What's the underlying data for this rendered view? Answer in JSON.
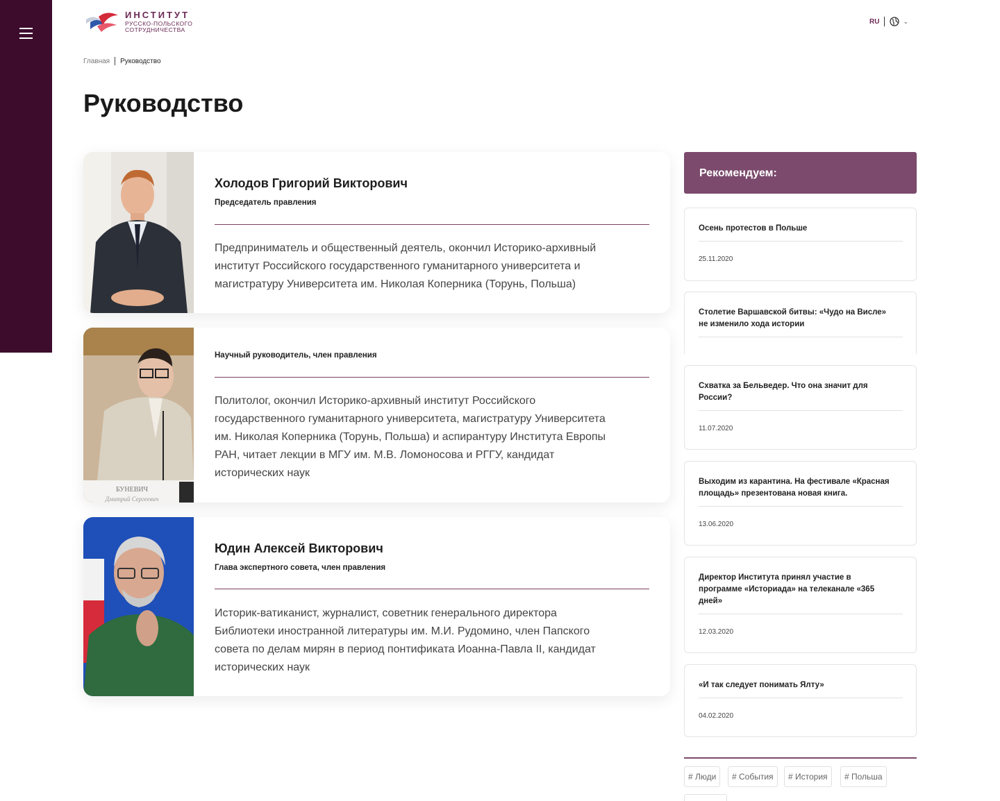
{
  "header": {
    "logo_title": "ИНСТИТУТ",
    "logo_line1": "РУССКО-ПОЛЬСКОГО",
    "logo_line2": "СОТРУДНИЧЕСТВА",
    "lang": "RU",
    "globe_icon": "globe-icon",
    "menu_icon": "hamburger-menu-icon"
  },
  "breadcrumb": {
    "home": "Главная",
    "current": "Руководство"
  },
  "page_title": "Руководство",
  "people": [
    {
      "name": "Холодов Григорий Викторович",
      "role": "Председатель правления",
      "desc_lines": [
        "Предприниматель и общественный деятель, окончил Историко-архивный",
        "институт Российского государственного гуманитарного университета и",
        "магистратуру Университета им. Николая Коперника (Торунь, Польша)"
      ]
    },
    {
      "name": "",
      "role": "Научный руководитель, член правления",
      "photo_caption_1": "БУНЕВИЧ",
      "photo_caption_2": "Дмитрий Сергеевич",
      "desc_lines": [
        "Политолог, окончил Историко-архивный институт Российского",
        "государственного гуманитарного университета, магистратуру Университета",
        "им. Николая Коперника (Торунь, Польша) и аспирантуру Института Европы",
        "РАН, читает лекции в МГУ им. М.В. Ломоносова и РГГУ, кандидат",
        "исторических наук"
      ]
    },
    {
      "name": "Юдин Алексей Викторович",
      "role": "Глава экспертного совета, член правления",
      "desc_lines": [
        "Историк-ватиканист, журналист, советник генерального директора",
        "Библиотеки иностранной литературы им. М.И. Рудомино, член Папского",
        "совета по делам мирян в период понтификата Иоанна-Павла II, кандидат",
        "исторических наук"
      ]
    }
  ],
  "recommend": {
    "heading": "Рекомендуем:",
    "items": [
      {
        "title_lines": [
          "Осень протестов в Польше"
        ],
        "date": "25.11.2020"
      },
      {
        "title_lines": [
          "Столетие Варшавской битвы: «Чудо на Висле»",
          "не изменило хода истории"
        ],
        "date": ""
      },
      {
        "title_lines": [
          "Схватка за Бельведер. Что она значит для",
          "России?"
        ],
        "date": "11.07.2020"
      },
      {
        "title_lines": [
          "Выходим из карантина. На фестивале «Красная",
          "площадь» презентована новая книга."
        ],
        "date": "13.06.2020"
      },
      {
        "title_lines": [
          "Директор Института принял участие в",
          "программе «Историада» на телеканале «365",
          "дней»"
        ],
        "date": "12.03.2020"
      },
      {
        "title_lines": [
          "«И так следует понимать Ялту»"
        ],
        "date": "04.02.2020"
      }
    ]
  },
  "tags": [
    "# Люди",
    "# События",
    "# История",
    "# Польша"
  ],
  "colors": {
    "sidebar": "#3d0c2c",
    "accent": "#7b4a6c"
  }
}
